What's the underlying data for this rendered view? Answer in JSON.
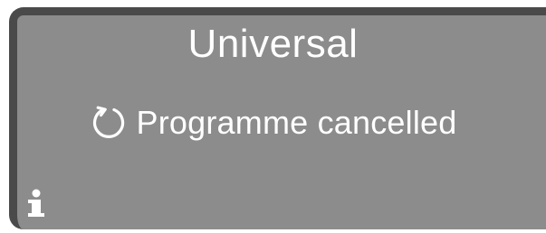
{
  "display": {
    "title": "Universal",
    "status": {
      "icon": "cancel-icon",
      "text": "Programme cancelled"
    },
    "info_icon": "info-icon"
  },
  "colors": {
    "screen_bg": "#8c8c8c",
    "bezel": "#4a4a4a",
    "text": "#ffffff"
  }
}
